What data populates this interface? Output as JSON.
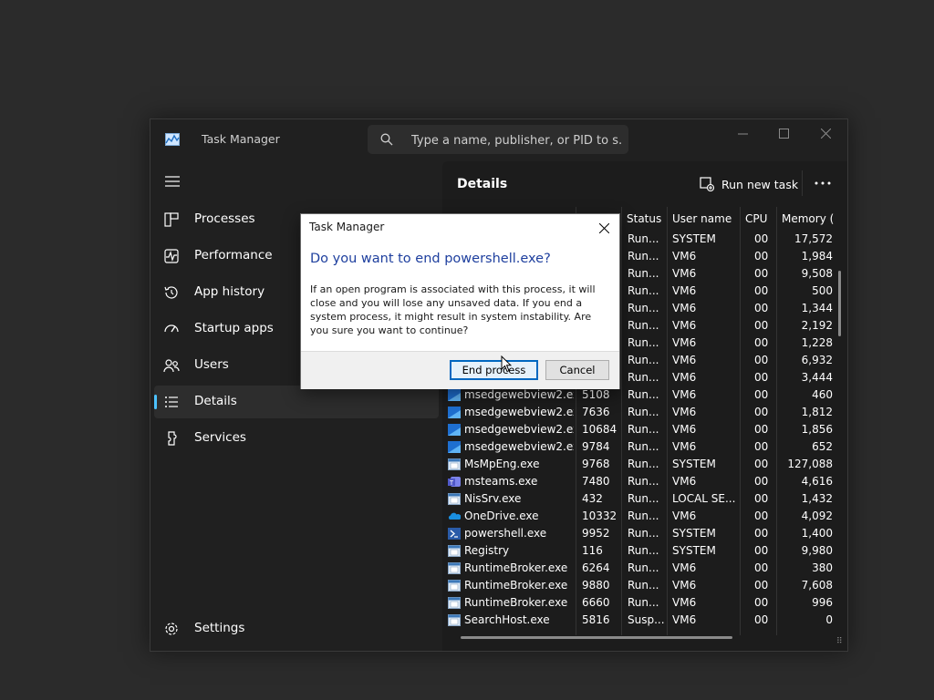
{
  "window": {
    "title": "Task Manager",
    "search_placeholder": "Type a name, publisher, or PID to s..."
  },
  "sidebar": {
    "items": [
      {
        "label": "Processes",
        "icon": "processes-icon"
      },
      {
        "label": "Performance",
        "icon": "performance-icon"
      },
      {
        "label": "App history",
        "icon": "app-history-icon"
      },
      {
        "label": "Startup apps",
        "icon": "startup-apps-icon"
      },
      {
        "label": "Users",
        "icon": "users-icon"
      },
      {
        "label": "Details",
        "icon": "details-icon",
        "active": true
      },
      {
        "label": "Services",
        "icon": "services-icon"
      }
    ],
    "settings_label": "Settings"
  },
  "main": {
    "title": "Details",
    "run_new_task": "Run new task",
    "columns": [
      "Status",
      "User name",
      "CPU",
      "Memory ("
    ],
    "rows": [
      {
        "name": "",
        "pid": "",
        "status": "Run...",
        "user": "SYSTEM",
        "cpu": "00",
        "mem": "17,572"
      },
      {
        "name": "",
        "pid": "",
        "status": "Run...",
        "user": "VM6",
        "cpu": "00",
        "mem": "1,984"
      },
      {
        "name": "",
        "pid": "",
        "status": "Run...",
        "user": "VM6",
        "cpu": "00",
        "mem": "9,508"
      },
      {
        "name": "",
        "pid": "",
        "status": "Run...",
        "user": "VM6",
        "cpu": "00",
        "mem": "500"
      },
      {
        "name": "",
        "pid": "",
        "status": "Run...",
        "user": "VM6",
        "cpu": "00",
        "mem": "1,344"
      },
      {
        "name": "",
        "pid": "",
        "status": "Run...",
        "user": "VM6",
        "cpu": "00",
        "mem": "2,192"
      },
      {
        "name": "",
        "pid": "",
        "status": "Run...",
        "user": "VM6",
        "cpu": "00",
        "mem": "1,228"
      },
      {
        "name": "",
        "pid": "",
        "status": "Run...",
        "user": "VM6",
        "cpu": "00",
        "mem": "6,932"
      },
      {
        "name": "",
        "pid": "",
        "status": "Run...",
        "user": "VM6",
        "cpu": "00",
        "mem": "3,444"
      },
      {
        "name": "msedgewebview2.exe",
        "pid": "5108",
        "status": "Run...",
        "user": "VM6",
        "cpu": "00",
        "mem": "460",
        "icon": "edge"
      },
      {
        "name": "msedgewebview2.exe",
        "pid": "7636",
        "status": "Run...",
        "user": "VM6",
        "cpu": "00",
        "mem": "1,812",
        "icon": "edge"
      },
      {
        "name": "msedgewebview2.exe",
        "pid": "10684",
        "status": "Run...",
        "user": "VM6",
        "cpu": "00",
        "mem": "1,856",
        "icon": "edge"
      },
      {
        "name": "msedgewebview2.exe",
        "pid": "9784",
        "status": "Run...",
        "user": "VM6",
        "cpu": "00",
        "mem": "652",
        "icon": "edge"
      },
      {
        "name": "MsMpEng.exe",
        "pid": "9768",
        "status": "Run...",
        "user": "SYSTEM",
        "cpu": "00",
        "mem": "127,088",
        "icon": "window"
      },
      {
        "name": "msteams.exe",
        "pid": "7480",
        "status": "Run...",
        "user": "VM6",
        "cpu": "00",
        "mem": "4,616",
        "icon": "teams"
      },
      {
        "name": "NisSrv.exe",
        "pid": "432",
        "status": "Run...",
        "user": "LOCAL SE...",
        "cpu": "00",
        "mem": "1,432",
        "icon": "window"
      },
      {
        "name": "OneDrive.exe",
        "pid": "10332",
        "status": "Run...",
        "user": "VM6",
        "cpu": "00",
        "mem": "4,092",
        "icon": "cloud"
      },
      {
        "name": "powershell.exe",
        "pid": "9952",
        "status": "Run...",
        "user": "SYSTEM",
        "cpu": "00",
        "mem": "1,400",
        "icon": "powershell"
      },
      {
        "name": "Registry",
        "pid": "116",
        "status": "Run...",
        "user": "SYSTEM",
        "cpu": "00",
        "mem": "9,980",
        "icon": "window"
      },
      {
        "name": "RuntimeBroker.exe",
        "pid": "6264",
        "status": "Run...",
        "user": "VM6",
        "cpu": "00",
        "mem": "380",
        "icon": "window"
      },
      {
        "name": "RuntimeBroker.exe",
        "pid": "9880",
        "status": "Run...",
        "user": "VM6",
        "cpu": "00",
        "mem": "7,608",
        "icon": "window"
      },
      {
        "name": "RuntimeBroker.exe",
        "pid": "6660",
        "status": "Run...",
        "user": "VM6",
        "cpu": "00",
        "mem": "996",
        "icon": "window"
      },
      {
        "name": "SearchHost.exe",
        "pid": "5816",
        "status": "Susp...",
        "user": "VM6",
        "cpu": "00",
        "mem": "0",
        "icon": "window"
      }
    ]
  },
  "dialog": {
    "title": "Task Manager",
    "heading": "Do you want to end powershell.exe?",
    "message": "If an open program is associated with this process, it will close and you will lose any unsaved data. If you end a system process, it might result in system instability. Are you sure you want to continue?",
    "confirm_label": "End process",
    "cancel_label": "Cancel"
  },
  "colors": {
    "accent": "#4cc2ff",
    "dialog_heading": "#1e3f9e",
    "primary_border": "#0067c0"
  }
}
